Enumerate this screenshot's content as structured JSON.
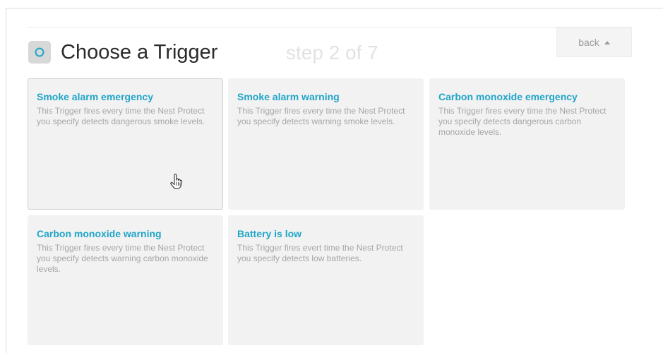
{
  "header": {
    "title": "Choose a Trigger",
    "step": "step 2 of 7",
    "back_label": "back",
    "icon": "circle-trigger-icon",
    "accent_color": "#20a5c8"
  },
  "triggers": [
    {
      "title": "Smoke alarm emergency",
      "description": "This Trigger fires every time the Nest Protect you specify detects dangerous smoke levels."
    },
    {
      "title": "Smoke alarm warning",
      "description": "This Trigger fires every time the Nest Protect you specify detects warning smoke levels."
    },
    {
      "title": "Carbon monoxide emergency",
      "description": "This Trigger fires every time the Nest Protect you specify detects dangerous carbon monoxide levels."
    },
    {
      "title": "Carbon monoxide warning",
      "description": "This Trigger fires every time the Nest Protect you specify detects warning carbon monoxide levels."
    },
    {
      "title": "Battery is low",
      "description": "This Trigger fires evert time the Nest Protect you specify detects low batteries."
    }
  ]
}
